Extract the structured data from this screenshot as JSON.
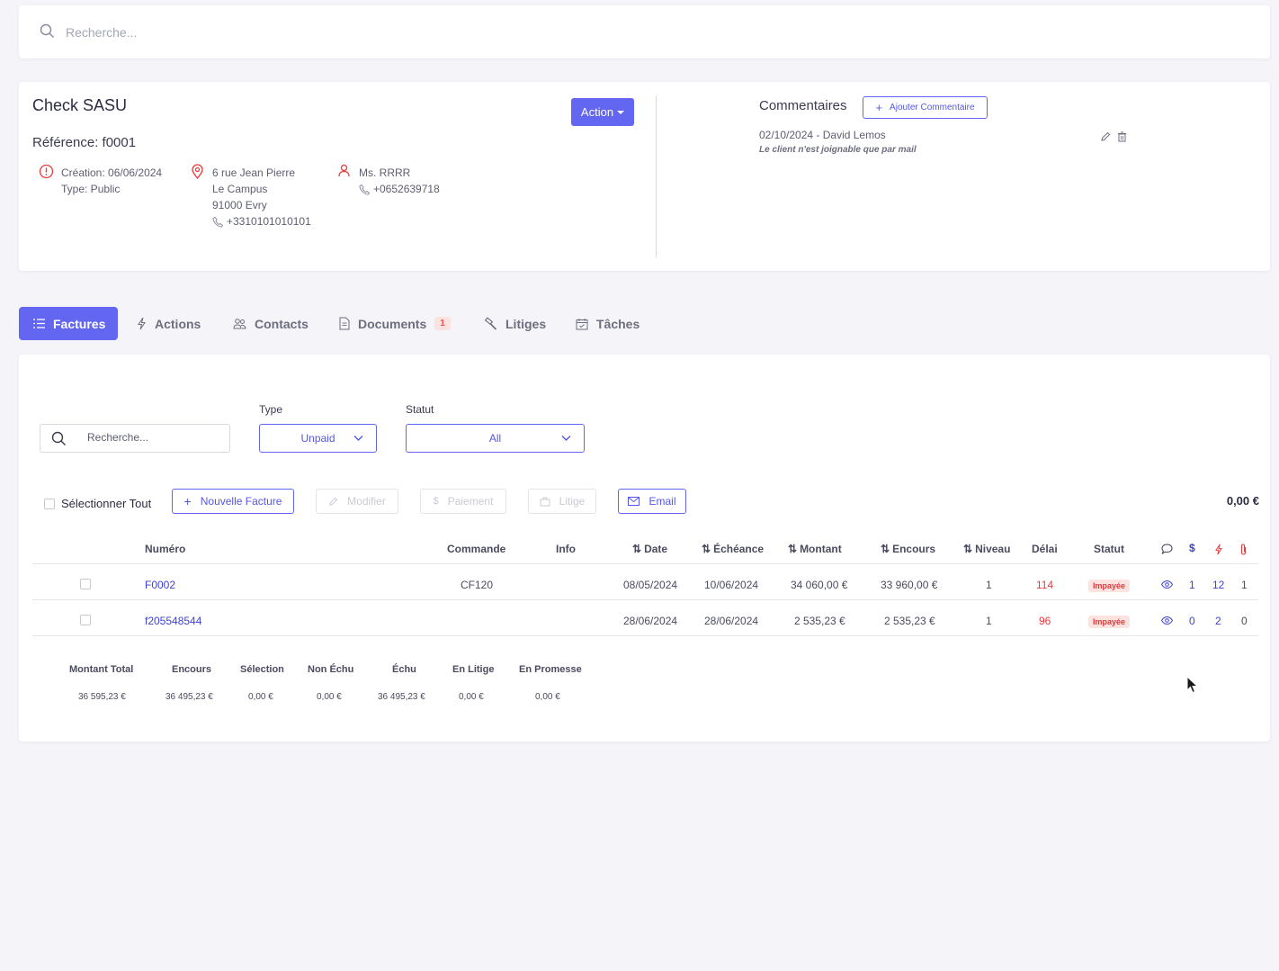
{
  "search": {
    "placeholder": "Recherche..."
  },
  "client": {
    "name": "Check SASU",
    "reference": "Référence: f0001",
    "action_label": "Action",
    "creation": "Création: 06/06/2024",
    "type": "Type: Public",
    "address": [
      "6 rue Jean Pierre",
      "Le Campus",
      "91000 Evry"
    ],
    "address_phone": "+3310101010101",
    "contact_name": "Ms. RRRR",
    "contact_phone": "+0652639718"
  },
  "comments": {
    "title": "Commentaires",
    "add_label": "Ajouter Commentaire",
    "items": [
      {
        "meta": "02/10/2024 - David Lemos",
        "text": "Le client n'est joignable que par mail"
      }
    ]
  },
  "tabs": [
    {
      "label": "Factures",
      "icon": "list-icon",
      "active": true
    },
    {
      "label": "Actions",
      "icon": "bolt-icon"
    },
    {
      "label": "Contacts",
      "icon": "users-icon"
    },
    {
      "label": "Documents",
      "icon": "document-icon",
      "badge": "1"
    },
    {
      "label": "Litiges",
      "icon": "hammer-icon"
    },
    {
      "label": "Tâches",
      "icon": "calendar-icon"
    }
  ],
  "filters": {
    "search_placeholder": "Recherche...",
    "type_label": "Type",
    "type_value": "Unpaid",
    "status_label": "Statut",
    "status_value": "All"
  },
  "toolbar": {
    "select_all": "Sélectionner Tout",
    "new_invoice": "Nouvelle Facture",
    "edit": "Modifier",
    "payment": "Paiement",
    "dispute": "Litige",
    "email": "Email",
    "selected_total": "0,00 €"
  },
  "table": {
    "headers": {
      "number": "Numéro",
      "order": "Commande",
      "info": "Info",
      "date": "Date",
      "due": "Échéance",
      "amount": "Montant",
      "outstanding": "Encours",
      "level": "Niveau",
      "delay": "Délai",
      "status": "Statut"
    },
    "rows": [
      {
        "number": "F0002",
        "order": "CF120",
        "date": "08/05/2024",
        "due": "10/06/2024",
        "amount": "34 060,00 €",
        "outstanding": "33 960,00 €",
        "level": "1",
        "delay": "114",
        "status": "Impayée",
        "comments": "1",
        "payments": "12",
        "attachments": "1"
      },
      {
        "number": "f205548544",
        "order": "",
        "date": "28/06/2024",
        "due": "28/06/2024",
        "amount": "2 535,23 €",
        "outstanding": "2 535,23 €",
        "level": "1",
        "delay": "96",
        "status": "Impayée",
        "comments": "0",
        "payments": "2",
        "attachments": "0"
      }
    ]
  },
  "summary": {
    "headers": [
      "Montant Total",
      "Encours",
      "Sélection",
      "Non Échu",
      "Échu",
      "En Litige",
      "En Promesse"
    ],
    "values": [
      "36 595,23 €",
      "36 495,23 €",
      "0,00 €",
      "0,00 €",
      "36 495,23 €",
      "0,00 €",
      "0,00 €"
    ]
  },
  "colors": {
    "accent": "#6366f1",
    "danger": "#ea5455",
    "link": "#3d3fd9"
  }
}
